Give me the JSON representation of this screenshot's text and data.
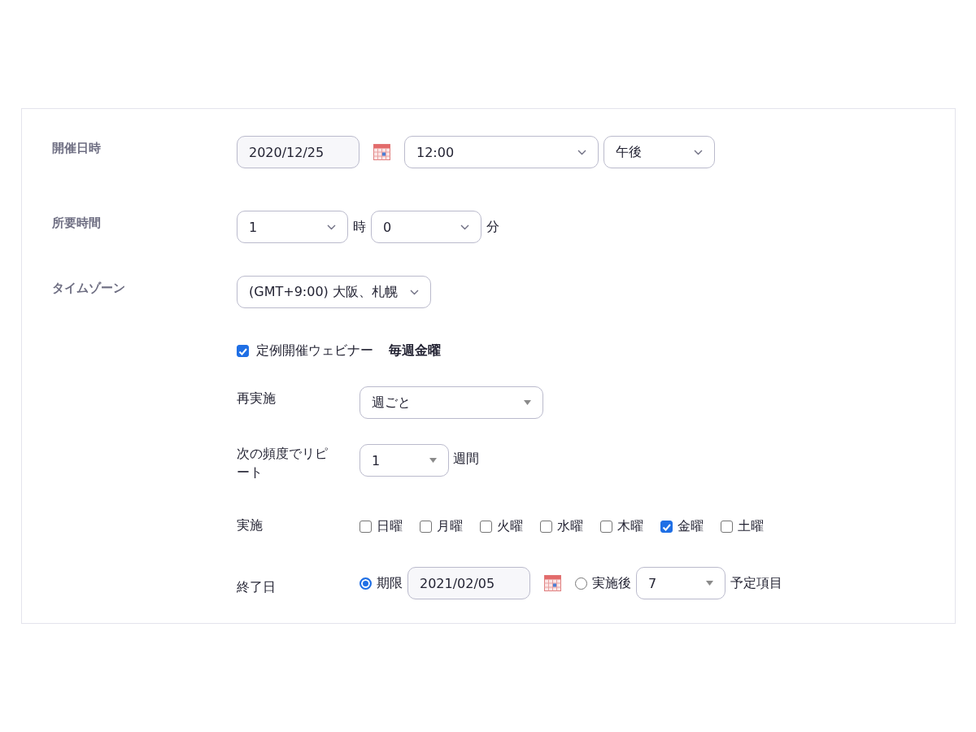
{
  "start": {
    "label": "開催日時",
    "date": "2020/12/25",
    "time": "12:00",
    "ampm": "午後"
  },
  "duration": {
    "label": "所要時間",
    "hours": "1",
    "hours_unit": "時",
    "minutes": "0",
    "minutes_unit": "分"
  },
  "timezone": {
    "label": "タイムゾーン",
    "value": "(GMT+9:00) 大阪、札幌"
  },
  "recurring": {
    "label": "定例開催ウェビナー",
    "checked": true,
    "summary": "毎週金曜"
  },
  "recurrence": {
    "label": "再実施",
    "value": "週ごと"
  },
  "repeat_every": {
    "label": "次の頻度でリピート",
    "value": "1",
    "unit": "週間"
  },
  "occurs_on": {
    "label": "実施",
    "days": [
      {
        "label": "日曜",
        "checked": false
      },
      {
        "label": "月曜",
        "checked": false
      },
      {
        "label": "火曜",
        "checked": false
      },
      {
        "label": "水曜",
        "checked": false
      },
      {
        "label": "木曜",
        "checked": false
      },
      {
        "label": "金曜",
        "checked": true
      },
      {
        "label": "土曜",
        "checked": false
      }
    ]
  },
  "end_date": {
    "label": "終了日",
    "options": [
      {
        "kind": "date",
        "label": "期限",
        "selected": true,
        "value": "2021/02/05"
      },
      {
        "kind": "count",
        "label": "実施後",
        "selected": false,
        "value": "7",
        "unit": "予定項目"
      }
    ]
  }
}
